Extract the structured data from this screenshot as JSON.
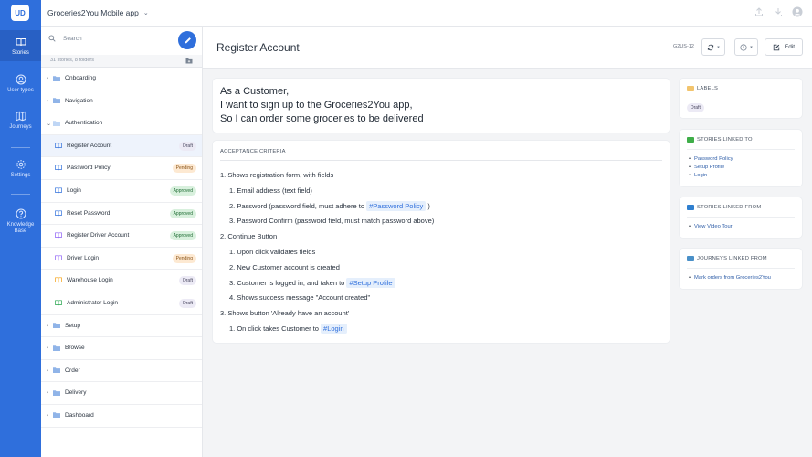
{
  "colors": {
    "accent": "#2f6fdc",
    "draft": "#eceaf5",
    "pending": "#fde9d2",
    "approved": "#d8f0dd"
  },
  "rail": {
    "logo": "UD",
    "items": [
      {
        "label": "Stories",
        "icon": "book-icon"
      },
      {
        "label": "User types",
        "icon": "user-circle-icon"
      },
      {
        "label": "Journeys",
        "icon": "map-icon"
      },
      {
        "label": "Settings",
        "icon": "gear-icon"
      },
      {
        "label": "Knowledge Base",
        "icon": "help-circle-icon"
      }
    ]
  },
  "topbar": {
    "app_title": "Groceries2You Mobile app"
  },
  "storypanel": {
    "search_placeholder": "Search",
    "count_text": "31 stories, 8 folders",
    "tree": [
      {
        "kind": "folder",
        "label": "Onboarding",
        "open": false
      },
      {
        "kind": "folder",
        "label": "Navigation",
        "open": false
      },
      {
        "kind": "folder",
        "label": "Authentication",
        "open": true
      },
      {
        "kind": "story",
        "label": "Register Account",
        "status": "Draft",
        "icon_color": "#2f6fdc",
        "active": true
      },
      {
        "kind": "story",
        "label": "Password Policy",
        "status": "Pending",
        "icon_color": "#2f6fdc"
      },
      {
        "kind": "story",
        "label": "Login",
        "status": "Approved",
        "icon_color": "#2f6fdc"
      },
      {
        "kind": "story",
        "label": "Reset Password",
        "status": "Approved",
        "icon_color": "#2f6fdc"
      },
      {
        "kind": "story",
        "label": "Register Driver Account",
        "status": "Approved",
        "icon_color": "#8b5cf6"
      },
      {
        "kind": "story",
        "label": "Driver Login",
        "status": "Pending",
        "icon_color": "#8b5cf6"
      },
      {
        "kind": "story",
        "label": "Warehouse Login",
        "status": "Draft",
        "icon_color": "#f59e0b"
      },
      {
        "kind": "story",
        "label": "Administrator Login",
        "status": "Draft",
        "icon_color": "#22a34a"
      },
      {
        "kind": "folder",
        "label": "Setup",
        "open": false
      },
      {
        "kind": "folder",
        "label": "Browse",
        "open": false
      },
      {
        "kind": "folder",
        "label": "Order",
        "open": false
      },
      {
        "kind": "folder",
        "label": "Delivery",
        "open": false
      },
      {
        "kind": "folder",
        "label": "Dashboard",
        "open": false
      }
    ]
  },
  "main": {
    "title": "Register Account",
    "story_id": "G2US-12",
    "edit_label": "Edit",
    "statement": [
      "As a Customer,",
      "I want to sign up to the Groceries2You app,",
      "So I can order some groceries to be delivered"
    ],
    "criteria_heading": "ACCEPTANCE CRITERIA",
    "criteria": [
      {
        "level": 0,
        "text": "1. Shows registration form, with fields"
      },
      {
        "level": 1,
        "text": "1. Email address (text field)"
      },
      {
        "level": 1,
        "text": "2. Password (password field, must adhere to",
        "tag": "#Password Policy",
        "after": ")"
      },
      {
        "level": 1,
        "text": "3. Password Confirm (password field, must match password above)"
      },
      {
        "level": 0,
        "text": "2. Continue Button"
      },
      {
        "level": 1,
        "text": "1. Upon click validates fields"
      },
      {
        "level": 1,
        "text": "2. New Customer account is created"
      },
      {
        "level": 1,
        "text": "3. Customer is logged in, and taken to",
        "tag": "#Setup Profile"
      },
      {
        "level": 1,
        "text": "4. Shows success message \"Account created\""
      },
      {
        "level": 0,
        "text": "3. Shows button 'Already have an account'"
      },
      {
        "level": 1,
        "text": "1. On click takes Customer to",
        "tag": "#Login"
      }
    ]
  },
  "sidebar": {
    "labels": {
      "heading": "LABELS",
      "chip": "Draft"
    },
    "linked_to": {
      "heading": "STORIES LINKED TO",
      "items": [
        "Password Policy",
        "Setup Profile",
        "Login"
      ]
    },
    "linked_from": {
      "heading": "STORIES LINKED FROM",
      "items": [
        "View Video Tour"
      ]
    },
    "journeys": {
      "heading": "JOURNEYS LINKED FROM",
      "items": [
        "Mark orders from Groceries2You"
      ]
    }
  }
}
